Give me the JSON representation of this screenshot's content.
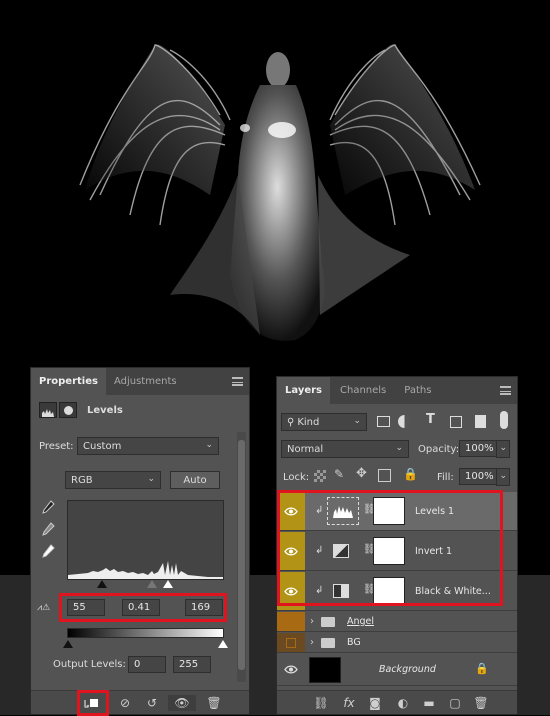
{
  "properties": {
    "tabs": [
      "Properties",
      "Adjustments"
    ],
    "title": "Levels",
    "preset_label": "Preset:",
    "preset_value": "Custom",
    "channel_value": "RGB",
    "auto_label": "Auto",
    "input_black": "55",
    "input_gamma": "0.41",
    "input_white": "169",
    "output_label": "Output Levels:",
    "output_black": "0",
    "output_white": "255"
  },
  "layers_panel": {
    "tabs": [
      "Layers",
      "Channels",
      "Paths"
    ],
    "filter_value": "Kind",
    "blend_mode": "Normal",
    "opacity_label": "Opacity:",
    "opacity_value": "100%",
    "lock_label": "Lock:",
    "fill_label": "Fill:",
    "fill_value": "100%",
    "layers": [
      {
        "name": "Levels 1"
      },
      {
        "name": "Invert 1"
      },
      {
        "name": "Black & White..."
      },
      {
        "name": "Angel"
      },
      {
        "name": "BG"
      },
      {
        "name": "Background"
      }
    ]
  },
  "colors": {
    "panel_bg": "#535353",
    "highlight_red": "#e0141e",
    "eye_gold": "#b39316",
    "eye_brown": "#a86a12"
  }
}
